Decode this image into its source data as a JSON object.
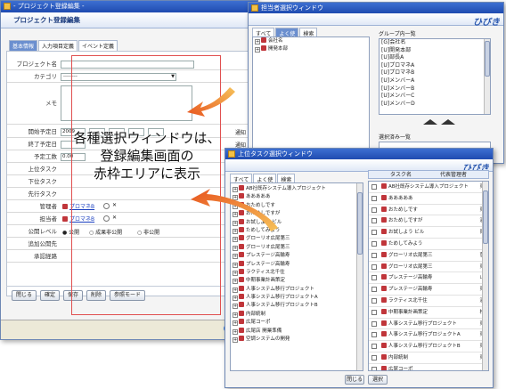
{
  "main_window": {
    "title": "- プロジェクト登録編集 -",
    "header": "プロジェクト登録編集",
    "tabs": [
      "基本情報",
      "入力項目定義",
      "イベント定義"
    ],
    "fields": [
      {
        "label": "プロジェクト名"
      },
      {
        "label": "カテゴリ",
        "value": "--------"
      },
      {
        "label": "メモ"
      },
      {
        "label": "開始予定日",
        "value": "2009"
      },
      {
        "label": "終了予定日"
      },
      {
        "label": "予定工数",
        "value": "0.00"
      },
      {
        "label": "上位タスク"
      },
      {
        "label": "下位タスク"
      },
      {
        "label": "先行タスク"
      },
      {
        "label": "管理者",
        "value": "プロマネB"
      },
      {
        "label": "担当者",
        "value": "プロマネB"
      },
      {
        "label": "公開レベル",
        "options": [
          "公開",
          "成果非公開",
          "非公開"
        ]
      },
      {
        "label": "追加公開先"
      },
      {
        "label": "承認経路"
      }
    ],
    "notify_labels": [
      "通知",
      "通知"
    ],
    "open_button": "開始",
    "buttons": [
      "閉じる",
      "確定",
      "保存",
      "削除",
      "参照モード"
    ],
    "status_text": "ir"
  },
  "annotation": {
    "lines": [
      "各種選択ウィンドウは、",
      "登録編集画面の",
      "赤枠エリアに表示"
    ],
    "color": "#e8541e"
  },
  "assignee_window": {
    "title": "担当者選択ウィンドウ",
    "logo": "ひびき",
    "tabs": [
      "すべて",
      "よく使",
      "検索"
    ],
    "tree": [
      "会社名",
      "開発本部"
    ],
    "group_header": "グループ内一覧",
    "group_list": [
      "[G]会社名",
      "[U]開発本部",
      "[U]部長A",
      "[U]プロマネA",
      "[U]プロマネB",
      "[U]メンバーA",
      "[U]メンバーB",
      "[U]メンバーC",
      "[U]メンバーD"
    ],
    "selected_header": "選択済み一覧"
  },
  "task_window": {
    "title": "上位タスク選択ウィンドウ",
    "logo": "ひびき",
    "tabs": [
      "すべて",
      "よく使",
      "検索"
    ],
    "tree": [
      "AB社既存システム導入プロジェクト",
      "あああああ",
      "おためしです",
      "おためしですが",
      "お試しよう ビル",
      "ためしてみよう",
      "グローリオ広尾第三",
      "グローリオ広尾第三",
      "プレステージ高輪寿",
      "プレステージ高輪寿",
      "ラクティス北千住",
      "中期事業計画策定",
      "人事システム移行プロジェクト",
      "人事システム移行プロジェクトA",
      "人事システム移行プロジェクトB",
      "内部統制",
      "広尾コーポ",
      "広尾店 開業準備",
      "空調システムの開発"
    ],
    "col_task": "タスク名",
    "col_manager": "代表管理者",
    "rows": [
      {
        "name": "AB社既存システム導入プロジェクト",
        "mgr": "東"
      },
      {
        "name": "あああああ",
        "mgr": ""
      },
      {
        "name": "おためしです",
        "mgr": "東"
      },
      {
        "name": "おためしですが",
        "mgr": "酒"
      },
      {
        "name": "お試しよう ビル",
        "mgr": "岡"
      },
      {
        "name": "ためしてみよう",
        "mgr": ""
      },
      {
        "name": "グローリオ広尾第三",
        "mgr": "菅"
      },
      {
        "name": "グローリオ広尾第三",
        "mgr": "東"
      },
      {
        "name": "プレステージ高輪寿",
        "mgr": "山"
      },
      {
        "name": "プレステージ高輪寿",
        "mgr": "東"
      },
      {
        "name": "ラクティス北千住",
        "mgr": "酒"
      },
      {
        "name": "中期事業計画策定",
        "mgr": "松"
      },
      {
        "name": "人事システム移行プロジェクト",
        "mgr": "東"
      },
      {
        "name": "人事システム移行プロジェクトA",
        "mgr": "東"
      },
      {
        "name": "人事システム移行プロジェクトB",
        "mgr": "東"
      },
      {
        "name": "内部統制",
        "mgr": "東"
      },
      {
        "name": "広尾コーポ",
        "mgr": ""
      },
      {
        "name": "広尾店 開業準備",
        "mgr": ""
      },
      {
        "name": "空調システムの開発",
        "mgr": ""
      }
    ],
    "buttons": [
      "閉じる",
      "選択"
    ]
  }
}
